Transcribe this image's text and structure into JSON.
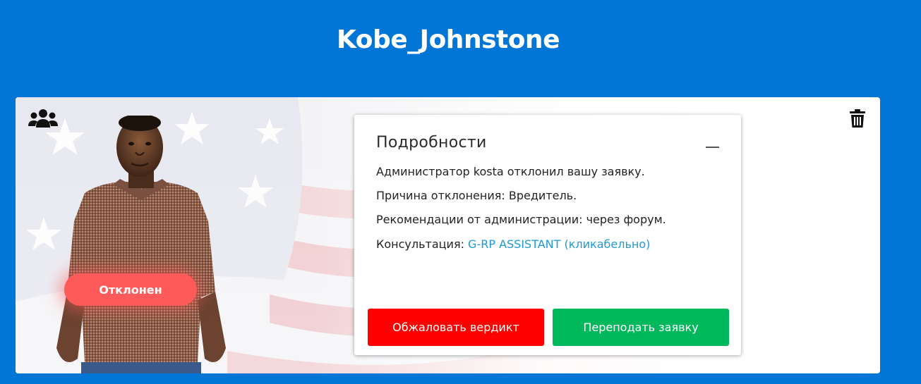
{
  "header": {
    "title": "Kobe_Johnstone"
  },
  "application": {
    "status": "Отклонен",
    "details": {
      "title": "Подробности",
      "lines": [
        "Администратор kosta отклонил вашу заявку.",
        "Причина отклонения: Вредитель.",
        "Рекомендации от администрации: через форум."
      ],
      "consult_prefix": "Консультация: ",
      "consult_link": "G-RP ASSISTANT (кликабельно)"
    },
    "buttons": {
      "appeal": "Обжаловать вердикт",
      "resubmit": "Переподать заявку"
    }
  },
  "icons": {
    "group": "users-group-icon",
    "delete": "trash-icon",
    "collapse": "minus-icon"
  },
  "colors": {
    "background": "#0276d6",
    "status_badge": "#ff5a5a",
    "appeal_button": "#ff0000",
    "resubmit_button": "#00b85c",
    "link": "#1a9bd7"
  }
}
